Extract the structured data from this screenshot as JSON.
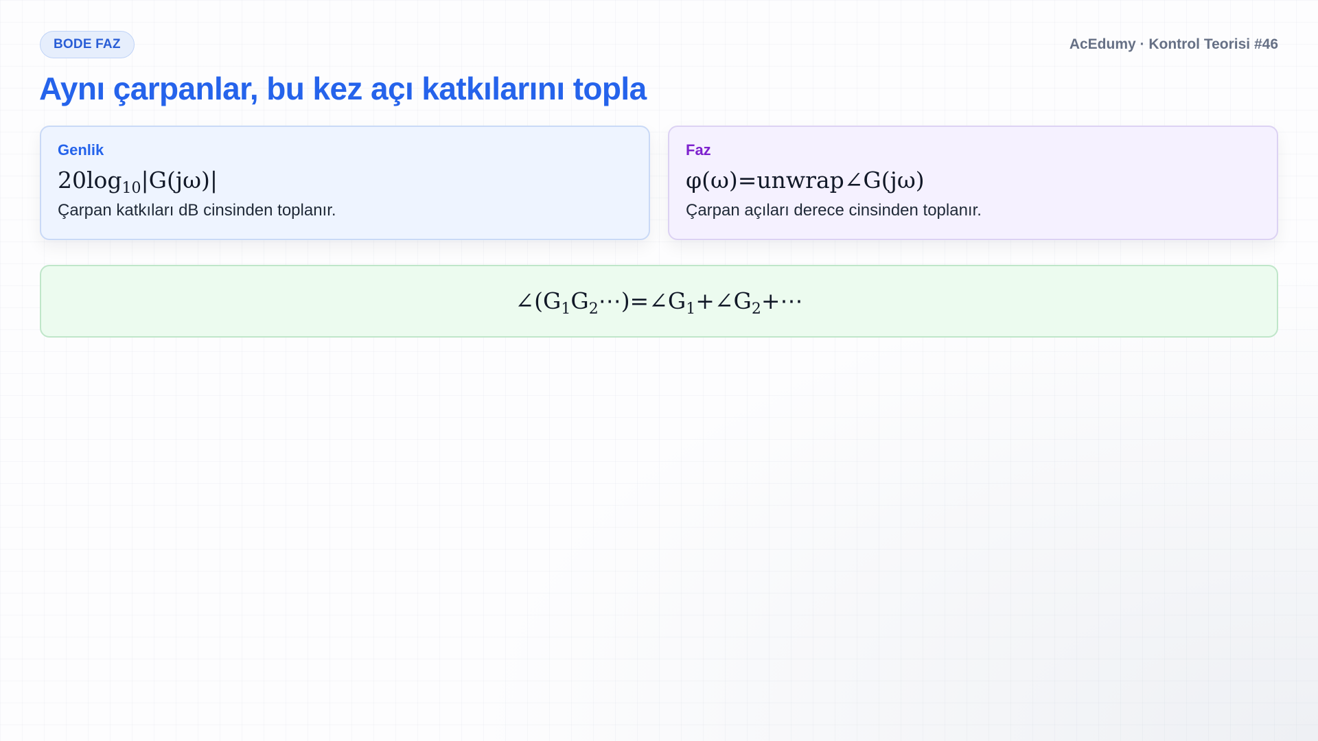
{
  "header": {
    "badge": "BODE FAZ",
    "brand": "AcEdumy · Kontrol Teorisi #46",
    "title": "Aynı çarpanlar, bu kez açı katkılarını topla"
  },
  "cards": {
    "magnitude": {
      "label": "Genlik",
      "formula_prefix": "20log",
      "formula_sub": "10",
      "formula_suffix": "|G(jω)|",
      "description": "Çarpan katkıları dB cinsinden toplanır."
    },
    "phase": {
      "label": "Faz",
      "formula": "φ(ω)=unwrap∠G(jω)",
      "description": "Çarpan açıları derece cinsinden toplanır."
    }
  },
  "summary": {
    "part1": "∠(G",
    "sub1": "1",
    "part2": "G",
    "sub2": "2",
    "part3": "⋯)=∠G",
    "sub3": "1",
    "part4": "+∠G",
    "sub4": "2",
    "part5": "+⋯"
  },
  "colors": {
    "accent": "#2563eb",
    "phase_accent": "#7e22ce",
    "magnitude_card_bg": "#eef4ff",
    "phase_card_bg": "#f5f1ff",
    "summary_bg": "#ecfbef"
  }
}
